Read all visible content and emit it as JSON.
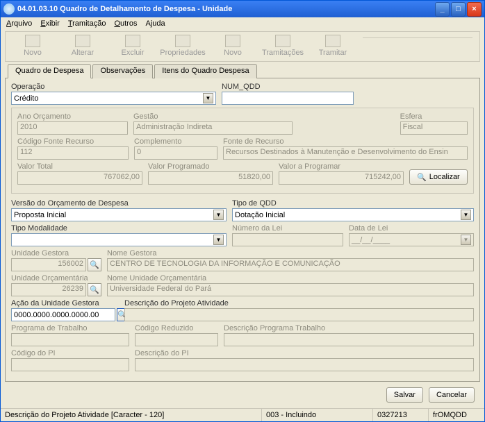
{
  "window": {
    "title": "04.01.03.10 Quadro de Detalhamento de Despesa - Unidade"
  },
  "menu": {
    "arquivo": "Arquivo",
    "exibir": "Exibir",
    "tramitacao": "Tramitação",
    "outros": "Outros",
    "ajuda": "Ajuda"
  },
  "toolbar": {
    "novo": "Novo",
    "alterar": "Alterar",
    "excluir": "Excluir",
    "propriedades": "Propriedades",
    "novo2": "Novo",
    "tramitacoes": "Tramitações",
    "tramitar": "Tramitar"
  },
  "tabs": {
    "t1": "Quadro de Despesa",
    "t2": "Observações",
    "t3": "Itens do Quadro Despesa"
  },
  "labels": {
    "operacao": "Operação",
    "numqdd": "NUM_QDD",
    "anoorc": "Ano Orçamento",
    "gestao": "Gestão",
    "esfera": "Esfera",
    "codfonte": "Código Fonte Recurso",
    "complemento": "Complemento",
    "fonterec": "Fonte de Recurso",
    "valtotal": "Valor Total",
    "valprog": "Valor Programado",
    "valaprog": "Valor a Programar",
    "versao": "Versão do Orçamento de Despesa",
    "tipoqdd": "Tipo de QDD",
    "tipomod": "Tipo Modalidade",
    "numlei": "Número da Lei",
    "datalei": "Data de Lei",
    "unidgest": "Unidade Gestora",
    "nomegest": "Nome Gestora",
    "unidorc": "Unidade Orçamentária",
    "nomeunidorc": "Nome Unidade Orçamentária",
    "acaoug": "Ação da Unidade Gestora",
    "descproj": "Descrição do Projeto Atividade",
    "progtrab": "Programa de Trabalho",
    "codred": "Código Reduzido",
    "descprog": "Descrição Programa Trabalho",
    "codpi": "Código do PI",
    "descpi": "Descrição do PI",
    "localizar": "Localizar",
    "salvar": "Salvar",
    "cancelar": "Cancelar"
  },
  "values": {
    "operacao": "Crédito",
    "numqdd": "",
    "anoorc": "2010",
    "gestao": "Administração Indireta",
    "esfera": "Fiscal",
    "codfonte": "112",
    "complemento": "0",
    "fonterec": "Recursos Destinados à Manutenção e Desenvolvimento do Ensin",
    "valtotal": "767062,00",
    "valprog": "51820,00",
    "valaprog": "715242,00",
    "versao": "Proposta Inicial",
    "tipoqdd": "Dotação Inicial",
    "tipomod": "",
    "numlei": "",
    "datalei": "__/__/____",
    "unidgest": "156002",
    "nomegest": "CENTRO DE TECNOLOGIA DA INFORMAÇÃO E COMUNICAÇÃO",
    "unidorc": "26239",
    "nomeunidorc": "Universidade Federal do Pará",
    "acaoug": "0000.0000.0000.0000.00",
    "descproj": "",
    "progtrab": "",
    "codred": "",
    "descprog": "",
    "codpi": "",
    "descpi": ""
  },
  "status": {
    "s1": "Descrição do Projeto Atividade [Caracter - 120]",
    "s2": "003 - Incluindo",
    "s3": "0327213",
    "s4": "frOMQDD"
  }
}
